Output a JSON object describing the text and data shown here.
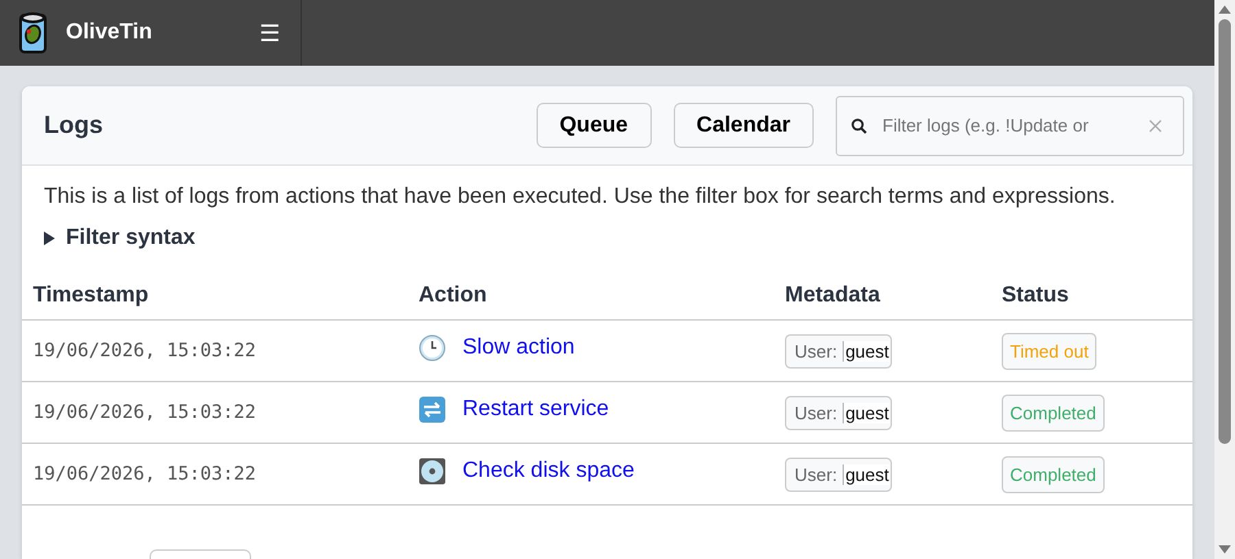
{
  "navbar": {
    "title": "OliveTin",
    "menu_icon": "☰"
  },
  "logs": {
    "title": "Logs",
    "buttons": [
      "Queue",
      "Calendar"
    ],
    "filter": {
      "placeholder": "Filter logs (e.g. !Update or"
    },
    "description": "This is a list of logs from actions that have been executed. Use the filter box for search terms and expressions.",
    "filter_syntax": {
      "label": "Filter syntax",
      "expanded": false
    },
    "table": {
      "columns": [
        "Timestamp",
        "Action",
        "Metadata",
        "Status"
      ],
      "rows": [
        {
          "timestamp": "19/06/2026, 15:03:22",
          "kind": "clock",
          "action": "Slow action",
          "meta_key": "User:",
          "meta_value": "guest",
          "status": "Timed out",
          "color": "#f5a20a"
        },
        {
          "timestamp": "19/06/2026, 15:03:22",
          "kind": "restart",
          "action": "Restart service",
          "meta_key": "User:",
          "meta_value": "guest",
          "status": "Completed",
          "color": "#3fae6a"
        },
        {
          "timestamp": "19/06/2026, 15:03:22",
          "kind": "disc",
          "action": "Check disk space",
          "meta_key": "User:",
          "meta_value": "guest",
          "status": "Completed",
          "color": "#3fae6a"
        }
      ]
    }
  }
}
